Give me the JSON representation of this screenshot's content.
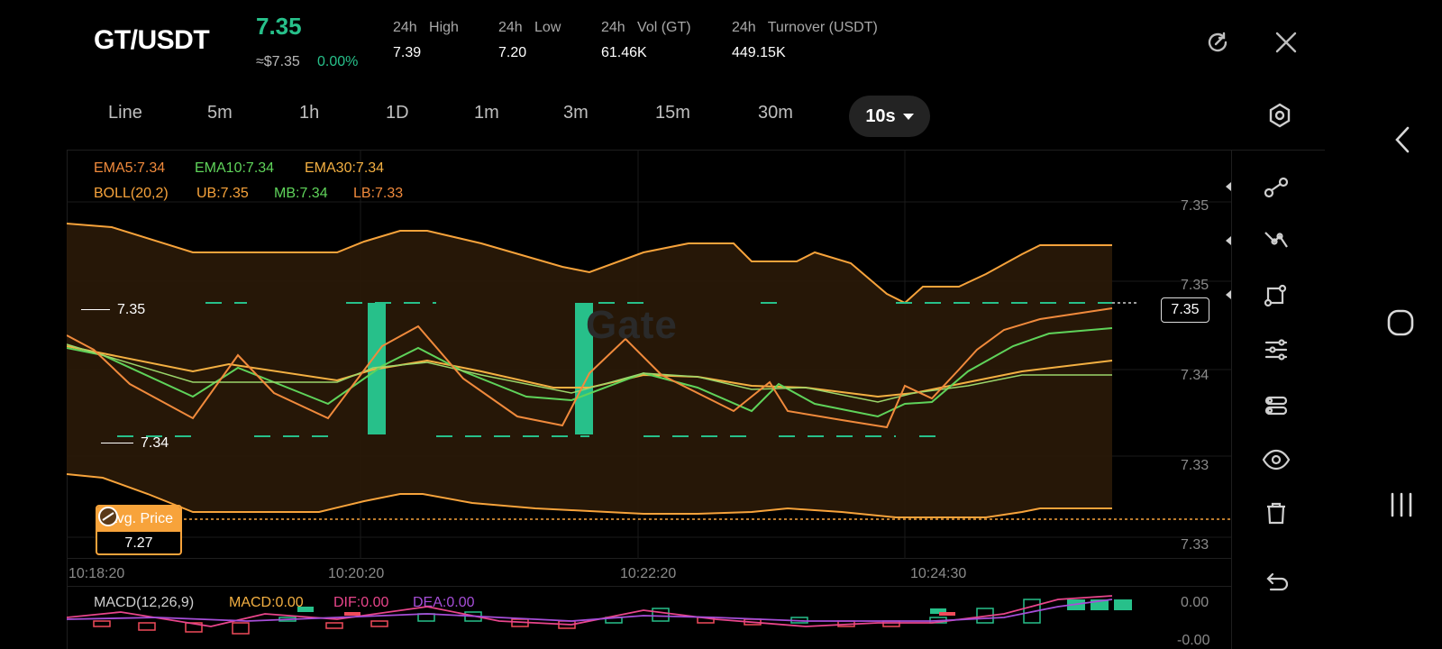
{
  "header": {
    "pair": "GT/USDT",
    "price": "7.35",
    "approx_price": "≈$7.35",
    "change": "0.00%",
    "stats": [
      {
        "label": "24h   High",
        "value": "7.39"
      },
      {
        "label": "24h   Low",
        "value": "7.20"
      },
      {
        "label": "24h   Vol (GT)",
        "value": "61.46K"
      },
      {
        "label": "24h   Turnover (USDT)",
        "value": "449.15K"
      }
    ],
    "icons": [
      "refresh-icon",
      "close-icon"
    ]
  },
  "timeframes": {
    "items": [
      "Line",
      "5m",
      "1h",
      "1D",
      "1m",
      "3m",
      "15m",
      "30m"
    ],
    "active": "10s"
  },
  "indicators": {
    "ema5": "EMA5:7.34",
    "ema10": "EMA10:7.34",
    "ema30": "EMA30:7.34",
    "boll": "BOLL(20,2)",
    "ub": "UB:7.35",
    "mb": "MB:7.34",
    "lb": "LB:7.33",
    "macd_name": "MACD(12,26,9)",
    "macd": "MACD:0.00",
    "dif": "DIF:0.00",
    "dea": "DEA:0.00"
  },
  "colors": {
    "ema5": "#f08a3c",
    "ema10": "#5fd35a",
    "ema30": "#f4b042",
    "boll": "#f7a33b",
    "up": "#27c08a",
    "down": "#f04b5b",
    "dif": "#e8458b",
    "dea": "#a64ed8"
  },
  "chart": {
    "y_ticks": [
      "7.35",
      "7.35",
      "7.34",
      "7.33",
      "7.33"
    ],
    "x_ticks": [
      "10:18:20",
      "10:20:20",
      "10:22:20",
      "10:24:30"
    ],
    "last_price": "7.35",
    "high_level_label": "7.35",
    "low_level_label": "7.34",
    "avg_price_label": "Avg. Price",
    "avg_price_value": "7.27",
    "watermark": "Gate",
    "macd_ticks": [
      "0.00",
      "-0.00"
    ]
  },
  "toolbar": [
    "trendline-icon",
    "ray-icon",
    "shape-icon",
    "indicator-settings-icon",
    "template-icon",
    "eye-icon",
    "trash-icon",
    "undo-icon"
  ],
  "nav": [
    "back-icon",
    "home-icon",
    "recents-icon"
  ]
}
